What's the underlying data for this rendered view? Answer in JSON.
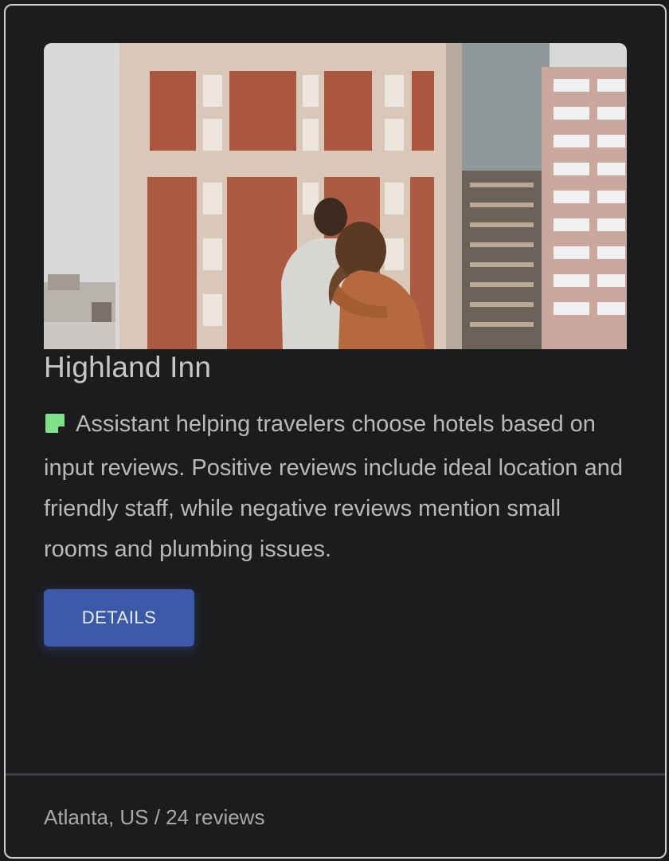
{
  "card": {
    "title": "Highland Inn",
    "image_alt": "Couple embracing on a rooftop looking at city buildings",
    "description": "Assistant helping travelers choose hotels based on input reviews. Positive reviews include ideal location and friendly staff, while negative reviews mention small rooms and plumbing issues.",
    "description_icon": "sticky-note-icon",
    "button_label": "DETAILS",
    "footer": "Atlanta, US / 24 reviews"
  },
  "colors": {
    "background": "#1b1c1e",
    "button": "#3b59a6",
    "note_icon": "#7ee08a",
    "title": "#c7c7c7",
    "text": "#b9b9b9"
  }
}
